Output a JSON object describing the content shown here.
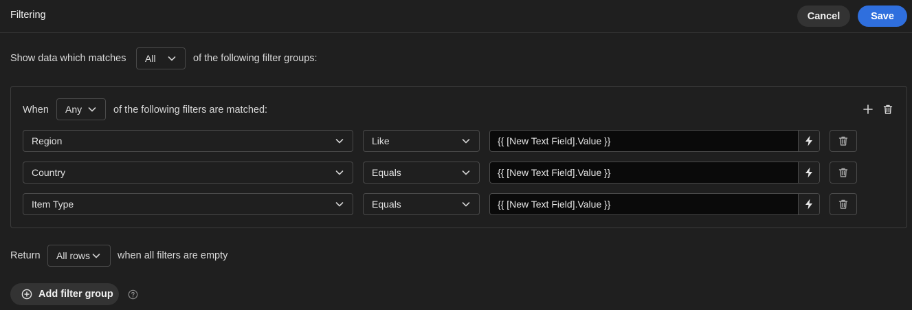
{
  "header": {
    "title": "Filtering",
    "cancel_label": "Cancel",
    "save_label": "Save"
  },
  "match": {
    "prefix": "Show data which matches",
    "selected": "All",
    "suffix": "of the following filter groups:"
  },
  "group": {
    "when_label": "When",
    "selected": "Any",
    "suffix": "of the following filters are matched:",
    "rows": [
      {
        "field": "Region",
        "operator": "Like",
        "value": "{{ [New Text Field].Value }}"
      },
      {
        "field": "Country",
        "operator": "Equals",
        "value": "{{ [New Text Field].Value }}"
      },
      {
        "field": "Item Type",
        "operator": "Equals",
        "value": "{{ [New Text Field].Value }}"
      }
    ]
  },
  "return": {
    "label": "Return",
    "selected": "All rows",
    "suffix": "when all filters are empty"
  },
  "add_group_label": "Add filter group",
  "icons": {
    "chevron": "chevron-down-icon",
    "bolt": "lightning-icon",
    "trash": "trash-icon",
    "plus": "plus-icon",
    "help": "help-circle-icon"
  },
  "colors": {
    "background": "#1f1f1f",
    "accent": "#2f6fde",
    "border": "#4a4a4a"
  }
}
